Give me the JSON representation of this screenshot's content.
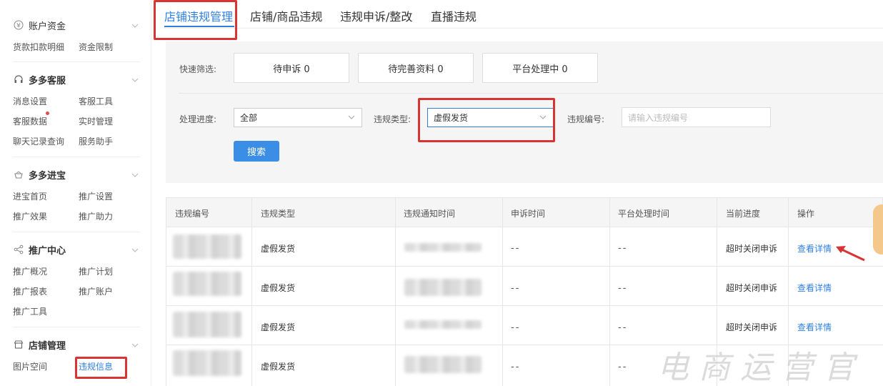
{
  "sidebar": {
    "sections": [
      {
        "title": "账户资金",
        "icon": "yen-icon",
        "items": [
          "货款扣款明细",
          "资金限制"
        ]
      },
      {
        "title": "多多客服",
        "icon": "headset-icon",
        "items": [
          "消息设置",
          "客服工具",
          "客服数据",
          "实时管理",
          "聊天记录查询",
          "服务助手"
        ]
      },
      {
        "title": "多多进宝",
        "icon": "treasure-icon",
        "items": [
          "进宝首页",
          "推广设置",
          "推广效果",
          "推广助力"
        ]
      },
      {
        "title": "推广中心",
        "icon": "share-icon",
        "items": [
          "推广概况",
          "推广计划",
          "推广报表",
          "推广账户",
          "推广工具"
        ]
      },
      {
        "title": "店铺管理",
        "icon": "store-icon",
        "items": [
          "图片空间",
          "违规信息"
        ]
      }
    ]
  },
  "tabs": [
    "店铺违规管理",
    "店铺/商品违规",
    "违规申诉/整改",
    "直播违规"
  ],
  "filter": {
    "quick_label": "快速筛选:",
    "quick": [
      "待申诉 0",
      "待完善资料 0",
      "平台处理中 0"
    ],
    "progress_label": "处理进度:",
    "progress_value": "全部",
    "type_label": "违规类型:",
    "type_value": "虚假发货",
    "id_label": "违规编号:",
    "id_placeholder": "请输入违规编号",
    "search_label": "搜索"
  },
  "table": {
    "headers": [
      "违规编号",
      "违规类型",
      "违规通知时间",
      "申诉时间",
      "平台处理时间",
      "当前进度",
      "操作"
    ],
    "rows": [
      {
        "type": "虚假发货",
        "appeal_time": "--",
        "platform_time": "--",
        "progress": "超时关闭申诉",
        "action": "查看详情"
      },
      {
        "type": "虚假发货",
        "appeal_time": "--",
        "platform_time": "--",
        "progress": "超时关闭申诉",
        "action": "查看详情"
      },
      {
        "type": "虚假发货",
        "appeal_time": "--",
        "platform_time": "--",
        "progress": "超时关闭申诉",
        "action": "查看详情"
      },
      {
        "type": "虚假发货",
        "appeal_time": "--",
        "platform_time": "--",
        "progress": "",
        "action": ""
      }
    ]
  },
  "watermark": "电商运营官",
  "colors": {
    "accent": "#2f7fe0",
    "highlight_box": "#d83434",
    "button": "#3a8ee6"
  }
}
